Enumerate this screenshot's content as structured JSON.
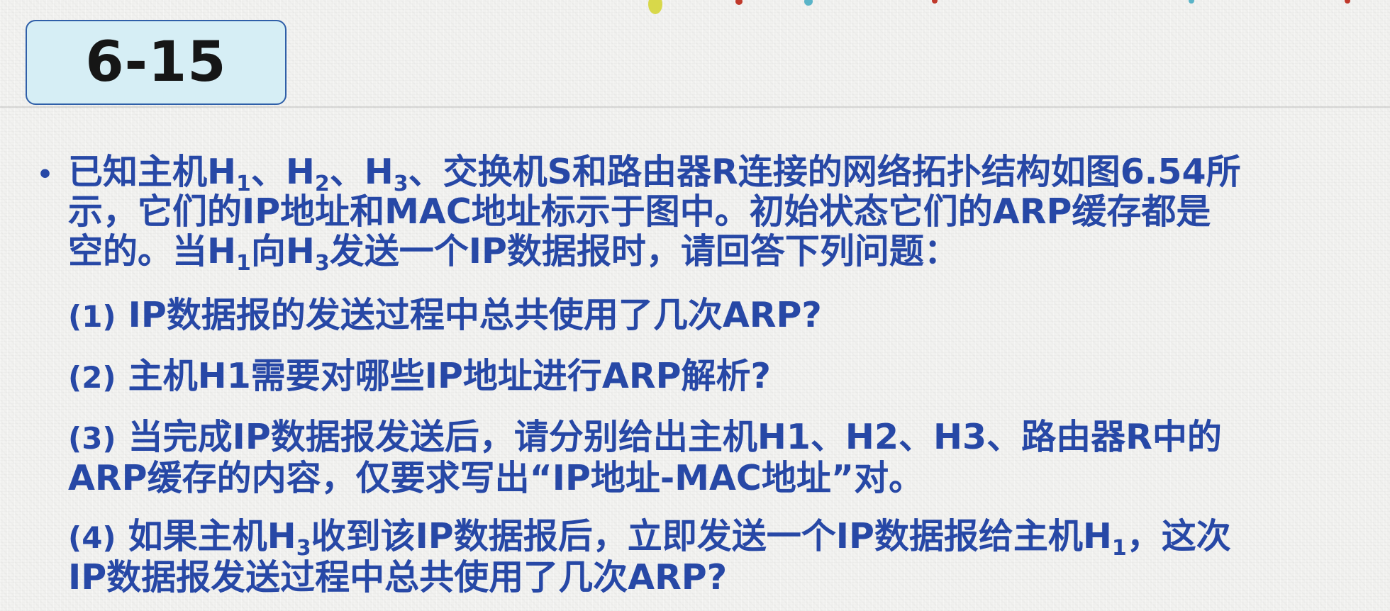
{
  "title": "6-15",
  "problem": {
    "intro": {
      "line1": {
        "a": "已知主机H",
        "sub1": "1",
        "b": "、H",
        "sub2": "2",
        "c": "、H",
        "sub3": "3",
        "d": "、交换机S和路由器R连接的网络拓扑结构如图6.54所"
      },
      "line2": "示，它们的IP地址和MAC地址标示于图中。初始状态它们的ARP缓存都是",
      "line3": {
        "a": "空的。当H",
        "sub1": "1",
        "b": "向H",
        "sub2": "3",
        "c": "发送一个IP数据报时，请回答下列问题："
      }
    },
    "questions": [
      {
        "num": "(1)",
        "text": " IP数据报的发送过程中总共使用了几次ARP?"
      },
      {
        "num": "(2)",
        "text": " 主机H1需要对哪些IP地址进行ARP解析?"
      },
      {
        "num": "(3)",
        "text": " 当完成IP数据报发送后，请分别给出主机H1、H2、H3、路由器R中的",
        "text2": "ARP缓存的内容，仅要求写出“IP地址-MAC地址”对。"
      },
      {
        "num": "(4)",
        "a": " 如果主机H",
        "sub1": "3",
        "b": "收到该IP数据报后，立即发送一个IP数据报给主机H",
        "sub2": "1",
        "c": "，这次",
        "text2": "IP数据报发送过程中总共使用了几次ARP?"
      }
    ]
  },
  "colors": {
    "text": "#2748a6",
    "title_box_fill": "#d6eef5",
    "title_box_border": "#2f5fa8"
  }
}
